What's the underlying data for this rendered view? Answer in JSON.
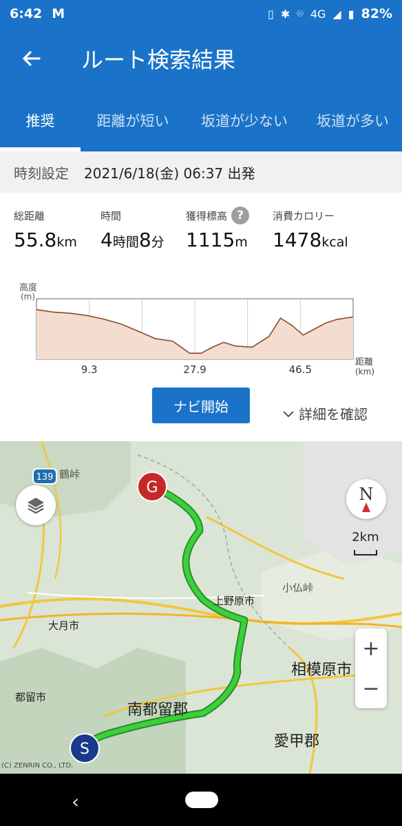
{
  "status": {
    "time": "6:42",
    "network": "4G",
    "battery": "82%"
  },
  "header": {
    "title": "ルート検索結果"
  },
  "tabs": [
    "推奨",
    "距離が短い",
    "坂道が少ない",
    "坂道が多い"
  ],
  "time_setting": {
    "label": "時刻設定",
    "value": "2021/6/18(金) 06:37 出発"
  },
  "stats": {
    "distance": {
      "label": "総距離",
      "value": "55.8",
      "unit": "km"
    },
    "duration": {
      "label": "時間",
      "h": "4",
      "h_unit": "時間",
      "m": "8",
      "m_unit": "分"
    },
    "elevation_gain": {
      "label": "獲得標高",
      "value": "1115",
      "unit": "m"
    },
    "calories": {
      "label": "消費カロリー",
      "value": "1478",
      "unit": "kcal"
    }
  },
  "profile": {
    "y_label": "高度",
    "y_unit": "(m)",
    "x_label": "距離",
    "x_unit": "(km)",
    "ticks": [
      "9.3",
      "27.9",
      "46.5"
    ]
  },
  "chart_data": {
    "type": "area",
    "xlabel": "距離 (km)",
    "ylabel": "高度 (m)",
    "x_ticks": [
      9.3,
      27.9,
      46.5
    ],
    "xlim": [
      0,
      55.8
    ],
    "x": [
      0,
      3,
      6,
      9,
      12,
      15,
      18,
      21,
      24,
      27,
      29,
      31,
      33,
      35,
      38,
      41,
      43,
      45,
      47,
      49,
      51,
      53,
      55.8
    ],
    "y": [
      0.82,
      0.78,
      0.76,
      0.72,
      0.66,
      0.58,
      0.46,
      0.34,
      0.3,
      0.1,
      0.1,
      0.2,
      0.28,
      0.22,
      0.2,
      0.38,
      0.68,
      0.56,
      0.4,
      0.5,
      0.6,
      0.66,
      0.7
    ]
  },
  "actions": {
    "start_nav": "ナビ開始",
    "details": "詳細を確認"
  },
  "map": {
    "marker_goal": "G",
    "marker_start": "S",
    "route_badge": "139",
    "scale": "2km",
    "compass": "N",
    "zoom_in": "+",
    "zoom_out": "−",
    "copyright": "(C) ZENRIN CO., LTD.",
    "labels": [
      "上野原市",
      "大月市",
      "都留市",
      "南都留郡",
      "相模原市",
      "愛甲郡",
      "小仏峠",
      "鶴峠"
    ]
  },
  "colors": {
    "primary": "#1a73c8",
    "route": "#3ad13a",
    "goal": "#c62828",
    "start": "#1a3a8c"
  }
}
